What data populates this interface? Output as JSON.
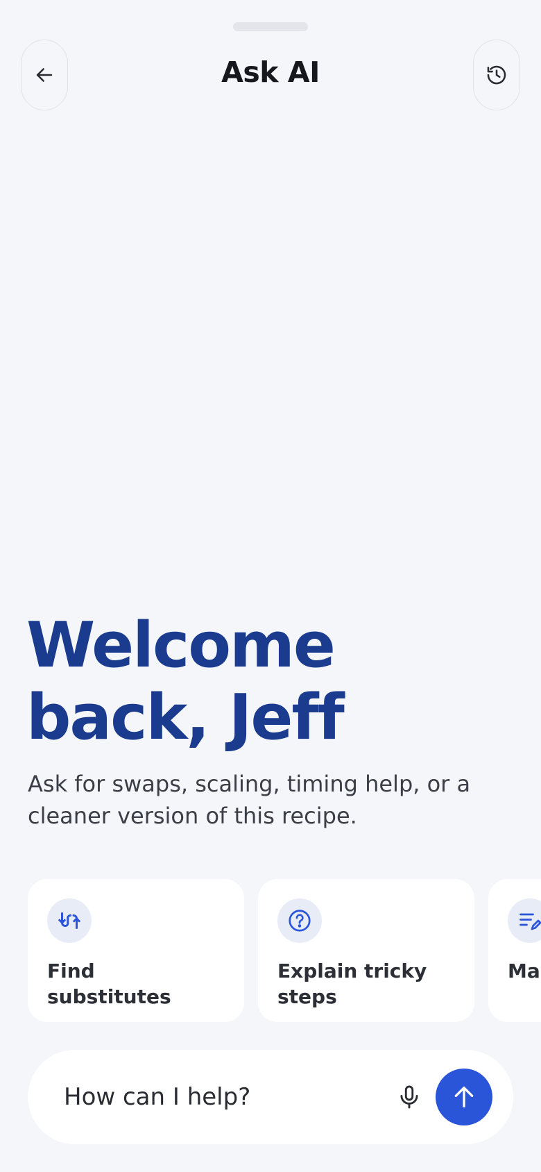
{
  "header": {
    "title": "Ask AI",
    "back_icon": "arrow-left-icon",
    "history_icon": "history-icon"
  },
  "hero": {
    "greeting_line1": "Welcome",
    "greeting_line2": "back, Jeff",
    "subtitle": "Ask for swaps, scaling, timing help, or a cleaner version of this recipe."
  },
  "suggestions": [
    {
      "label": "Find substitutes",
      "icon": "swap-arrows-icon"
    },
    {
      "label": "Explain tricky steps",
      "icon": "question-icon"
    },
    {
      "label": "Mak",
      "icon": "edit-list-icon"
    }
  ],
  "composer": {
    "placeholder": "How can I help?",
    "mic_icon": "microphone-icon",
    "send_icon": "arrow-up-icon"
  },
  "colors": {
    "background": "#f4f6f9",
    "heading_blue": "#1a3b8e",
    "accent_blue": "#2b55d8",
    "card_icon_bg": "#e8ecf6"
  }
}
